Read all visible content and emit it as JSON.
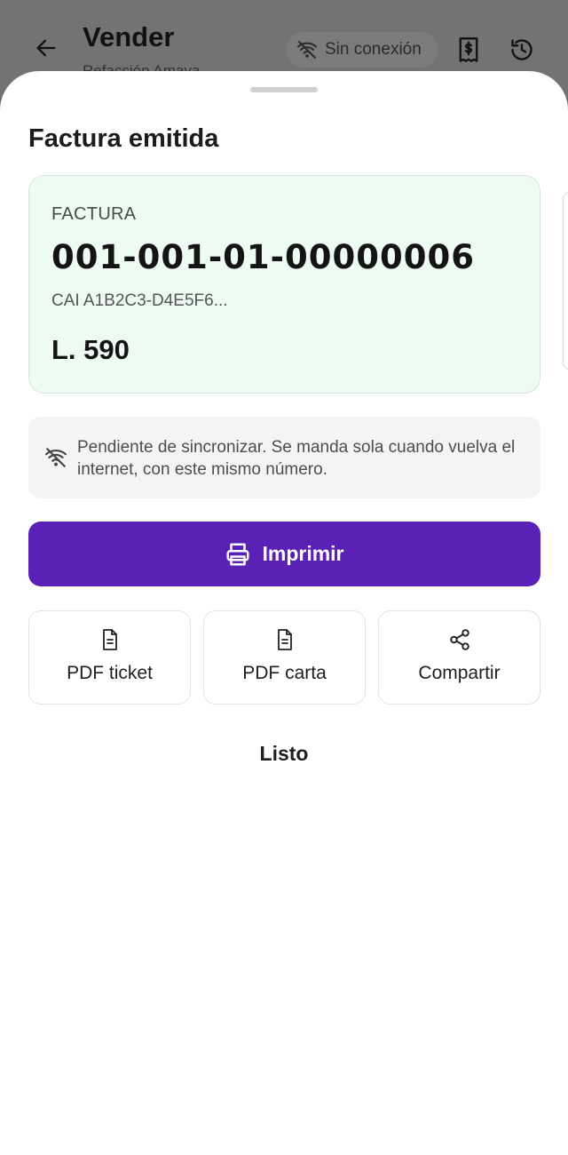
{
  "appbar": {
    "title": "Vender",
    "subtitle": "Refacción Amaya",
    "offline_label": "Sin conexión"
  },
  "sheet": {
    "title": "Factura emitida"
  },
  "invoice": {
    "label": "FACTURA",
    "number": "001-001-01-00000006",
    "cai": "CAI A1B2C3-D4E5F6...",
    "total": "L. 590"
  },
  "sync_note": {
    "text": "Pendiente de sincronizar. Se manda sola cuando vuelva el internet, con este mismo número."
  },
  "actions": {
    "print_label": "Imprimir",
    "pdf_ticket_label": "PDF ticket",
    "pdf_letter_label": "PDF carta",
    "share_label": "Compartir",
    "done_label": "Listo"
  },
  "colors": {
    "primary": "#5b21b6",
    "card_bg": "#eefbf3",
    "note_bg": "#f4f4f4"
  },
  "icons": {
    "back": "arrow-left-icon",
    "offline": "wifi-off-icon",
    "receipt": "receipt-dollar-icon",
    "history": "history-icon",
    "print": "printer-icon",
    "pdf": "document-icon",
    "share": "share-icon"
  }
}
